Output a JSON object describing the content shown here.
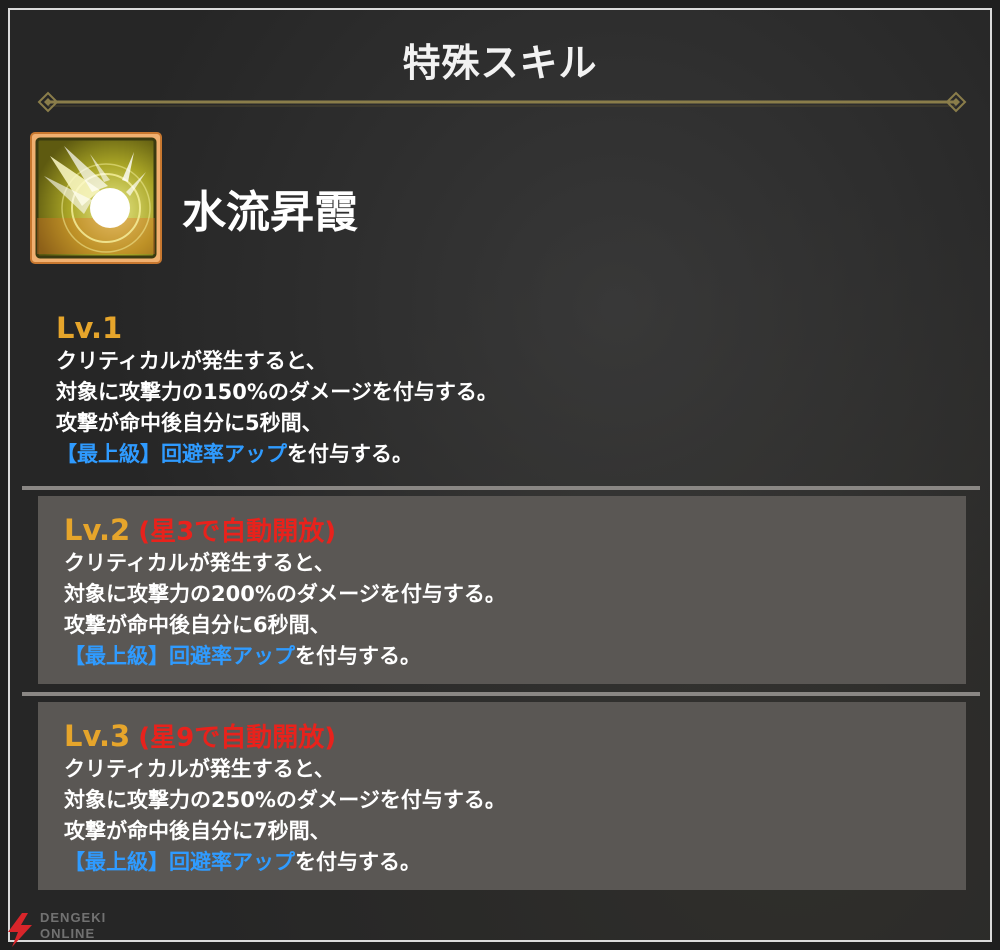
{
  "dialog": {
    "title": "特殊スキル"
  },
  "skill": {
    "icon": "comet-burst-icon",
    "name": "水流昇霞"
  },
  "levels": [
    {
      "label": "Lv.1",
      "unlock": "",
      "line1": "クリティカルが発生すると、",
      "line2": "対象に攻撃力の150%のダメージを付与する。",
      "line3": "攻撃が命中後自分に5秒間、",
      "buff": "【最上級】回避率アップ",
      "line4_suffix": "を付与する。"
    },
    {
      "label": "Lv.2",
      "unlock": "(星3で自動開放)",
      "line1": "クリティカルが発生すると、",
      "line2": "対象に攻撃力の200%のダメージを付与する。",
      "line3": "攻撃が命中後自分に6秒間、",
      "buff": "【最上級】回避率アップ",
      "line4_suffix": "を付与する。"
    },
    {
      "label": "Lv.3",
      "unlock": "(星9で自動開放)",
      "line1": "クリティカルが発生すると、",
      "line2": "対象に攻撃力の250%のダメージを付与する。",
      "line3": "攻撃が命中後自分に7秒間、",
      "buff": "【最上級】回避率アップ",
      "line4_suffix": "を付与する。"
    }
  ],
  "watermark": {
    "line1": "DENGEKI",
    "line2": "ONLINE"
  },
  "colors": {
    "level_label": "#e6a52b",
    "unlock_text": "#e8221c",
    "buff_text": "#2f9bff",
    "boxed_bg": "#5a5754",
    "divider_gold": "#8a7d4a"
  }
}
